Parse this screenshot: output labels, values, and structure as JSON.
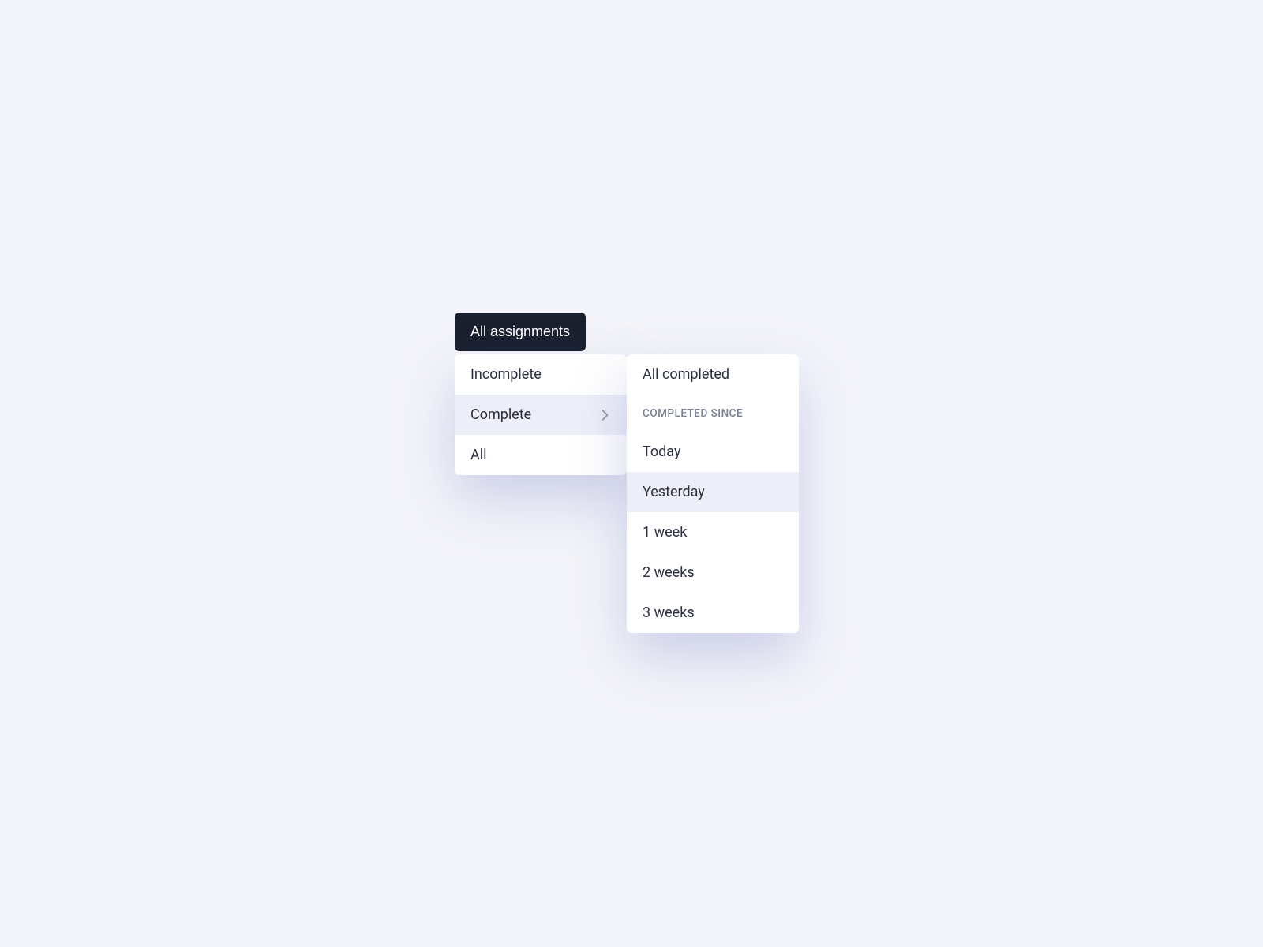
{
  "trigger": {
    "label": "All assignments"
  },
  "primaryMenu": {
    "items": [
      {
        "label": "Incomplete",
        "highlighted": false,
        "hasSubmenu": false
      },
      {
        "label": "Complete",
        "highlighted": true,
        "hasSubmenu": true
      },
      {
        "label": "All",
        "highlighted": false,
        "hasSubmenu": false
      }
    ]
  },
  "secondaryMenu": {
    "topItems": [
      {
        "label": "All completed",
        "highlighted": false
      }
    ],
    "sectionHeader": "Completed since",
    "timeItems": [
      {
        "label": "Today",
        "highlighted": false
      },
      {
        "label": "Yesterday",
        "highlighted": true
      },
      {
        "label": "1 week",
        "highlighted": false
      },
      {
        "label": "2 weeks",
        "highlighted": false
      },
      {
        "label": "3 weeks",
        "highlighted": false
      }
    ]
  }
}
